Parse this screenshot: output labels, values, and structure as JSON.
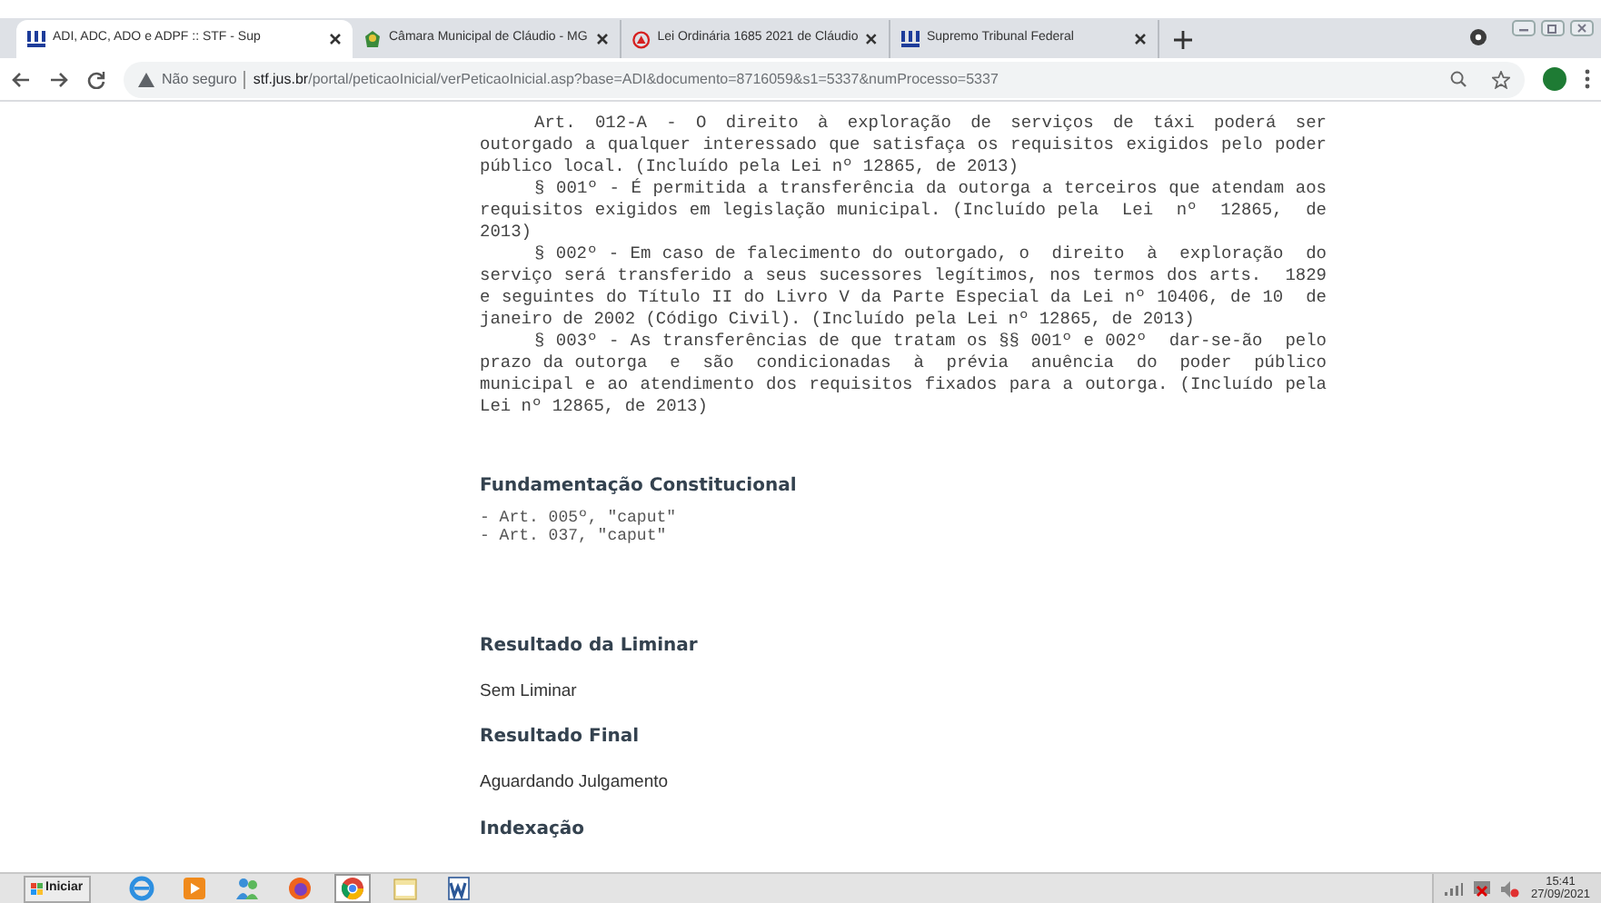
{
  "browser": {
    "tabs": [
      {
        "title": "ADI, ADC, ADO e ADPF :: STF - Sup",
        "kind": "stf",
        "selected": true
      },
      {
        "title": "Câmara Municipal de Cláudio - MG",
        "kind": "crest",
        "selected": false
      },
      {
        "title": "Lei Ordinária 1685 2021 de Cláudio",
        "kind": "red",
        "selected": false
      },
      {
        "title": "Supremo Tribunal Federal",
        "kind": "stf",
        "selected": false
      }
    ],
    "address": {
      "security": "Não seguro",
      "domain": "stf.jus.br",
      "path": "/portal/peticaoInicial/verPeticaoInicial.asp?base=ADI&documento=8716059&s1=5337&numProcesso=5337"
    }
  },
  "page": {
    "articles": [
      {
        "lines": [
          "Art. 012-A - O direito à exploração de serviços de táxi poderá ser",
          "outorgado a qualquer interessado que satisfaça os requisitos exigidos pelo poder",
          "público local. (Incluído pela Lei nº 12865, de 2013)"
        ]
      },
      {
        "lines": [
          "§ 001º - É permitida a transferência da outorga a terceiros que atendam aos",
          "requisitos exigidos em legislação municipal. (Incluído pela  Lei  nº  12865,  de",
          "2013)"
        ]
      },
      {
        "lines": [
          "§ 002º - Em caso de falecimento do outorgado, o  direito  à  exploração  do",
          "serviço será transferido a seus sucessores legítimos, nos termos dos arts.  1829",
          "e seguintes do Título II do Livro V da Parte Especial da Lei nº 10406, de 10  de",
          "janeiro de 2002 (Código Civil). (Incluído pela Lei nº 12865, de 2013)"
        ]
      },
      {
        "lines": [
          "§ 003º - As transferências de que tratam os §§ 001º e 002º  dar-se-ão  pelo",
          "prazo da outorga  e  são  condicionadas  à  prévia  anuência  do  poder  público",
          "municipal e ao atendimento dos requisitos fixados para a outorga. (Incluído pela",
          "Lei nº 12865, de 2013)"
        ]
      }
    ],
    "sections": [
      {
        "kind": "heading",
        "text": "Fundamentação Constitucional"
      },
      {
        "kind": "mono",
        "lines": [
          "- Art. 005º, \"caput\"",
          "- Art. 037, \"caput\""
        ]
      },
      {
        "kind": "heading",
        "text": "Resultado da Liminar"
      },
      {
        "kind": "text",
        "text": "Sem Liminar"
      },
      {
        "kind": "heading",
        "text": "Resultado Final"
      },
      {
        "kind": "text",
        "text": "Aguardando Julgamento"
      },
      {
        "kind": "heading",
        "text": "Indexação"
      }
    ]
  },
  "taskbar": {
    "start": "Iniciar",
    "apps": [
      {
        "kind": "ie",
        "selected": false
      },
      {
        "kind": "media",
        "selected": false
      },
      {
        "kind": "people",
        "selected": false
      },
      {
        "kind": "firefox",
        "selected": false
      },
      {
        "kind": "chrome",
        "selected": true
      },
      {
        "kind": "folder",
        "selected": false
      },
      {
        "kind": "word",
        "selected": false
      }
    ],
    "clock": {
      "time": "15:41",
      "date": "27/09/2021"
    }
  }
}
